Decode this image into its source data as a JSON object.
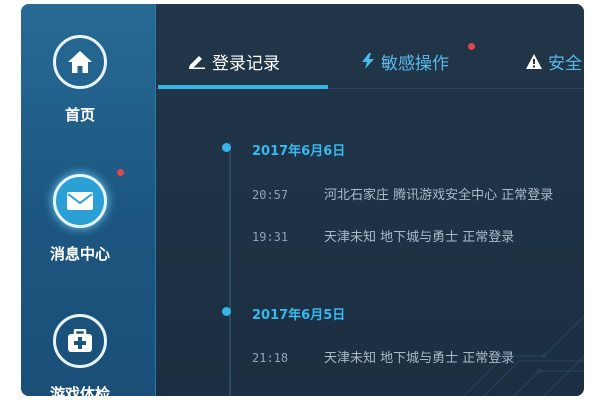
{
  "sidebar": {
    "items": [
      {
        "label": "首页",
        "icon": "home-icon",
        "active": false,
        "notification": false
      },
      {
        "label": "消息中心",
        "icon": "mail-icon",
        "active": true,
        "notification": true
      },
      {
        "label": "游戏体检",
        "icon": "medical-kit-icon",
        "active": false,
        "notification": false
      }
    ]
  },
  "tabs": [
    {
      "label": "登录记录",
      "icon": "pencil-icon",
      "active": true,
      "notification": false
    },
    {
      "label": "敏感操作",
      "icon": "lightning-icon",
      "active": false,
      "notification": true
    },
    {
      "label": "安全",
      "icon": "warning-icon",
      "active": false,
      "notification": false
    }
  ],
  "timeline": [
    {
      "date": "2017年6月6日",
      "records": [
        {
          "time": "20:57",
          "text": "河北石家庄 腾讯游戏安全中心 正常登录"
        },
        {
          "time": "19:31",
          "text": "天津未知 地下城与勇士 正常登录"
        }
      ]
    },
    {
      "date": "2017年6月5日",
      "records": [
        {
          "time": "21:18",
          "text": "天津未知 地下城与勇士 正常登录"
        }
      ]
    }
  ],
  "colors": {
    "accent": "#33b3e6",
    "sidebar": "#1c5680",
    "panel": "#1f3347",
    "badge": "#e0474c",
    "tab_active": "#ffffff",
    "tab_inactive": "#5ab8e8"
  }
}
